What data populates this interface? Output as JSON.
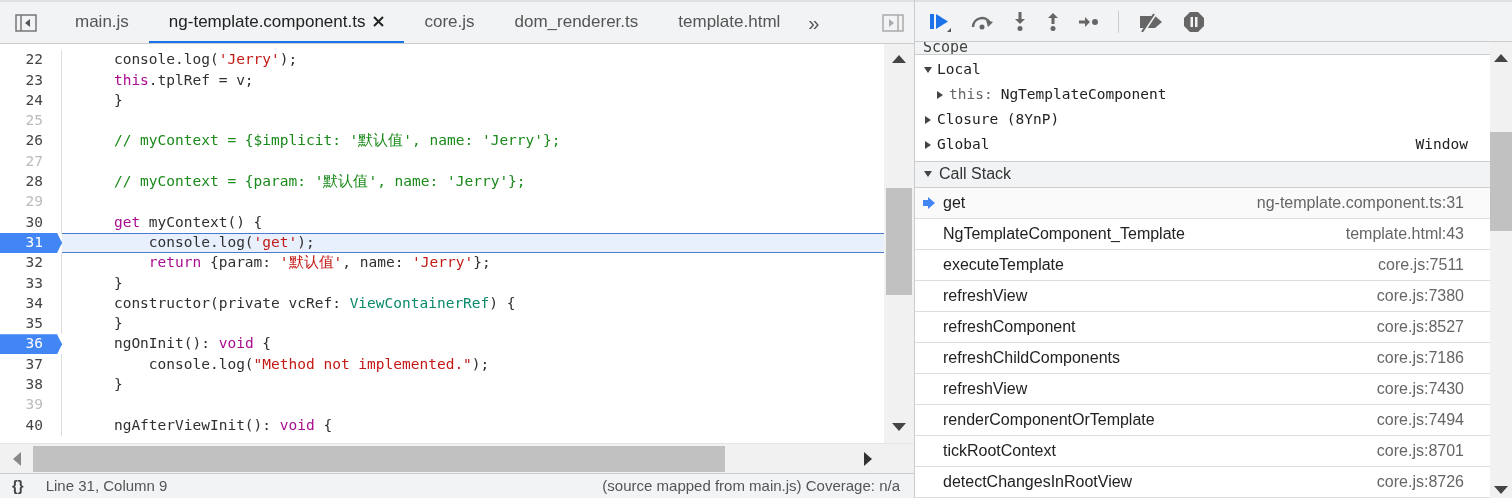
{
  "tabs": [
    {
      "label": "main.js",
      "selected": false,
      "closable": false
    },
    {
      "label": "ng-template.component.ts",
      "selected": true,
      "closable": true
    },
    {
      "label": "core.js",
      "selected": false,
      "closable": false
    },
    {
      "label": "dom_renderer.ts",
      "selected": false,
      "closable": false
    },
    {
      "label": "template.html",
      "selected": false,
      "closable": false
    }
  ],
  "tabs_overflow": "»",
  "code": [
    {
      "number": "22",
      "breakpoint": false,
      "current": false,
      "tokens": [
        {
          "kind": "plain",
          "text": "    console.log("
        },
        {
          "kind": "str",
          "text": "'Jerry'"
        },
        {
          "kind": "plain",
          "text": ");"
        }
      ]
    },
    {
      "number": "23",
      "breakpoint": false,
      "current": false,
      "tokens": [
        {
          "kind": "kw",
          "text": "    this"
        },
        {
          "kind": "plain",
          "text": ".tplRef = v;"
        }
      ]
    },
    {
      "number": "24",
      "breakpoint": false,
      "current": false,
      "tokens": [
        {
          "kind": "plain",
          "text": "    }"
        }
      ]
    },
    {
      "number": "25",
      "breakpoint": false,
      "current": false
    },
    {
      "number": "26",
      "breakpoint": false,
      "current": false,
      "tokens": [
        {
          "kind": "comment",
          "text": "    // myContext = {$implicit: '默认值', name: 'Jerry'};"
        }
      ]
    },
    {
      "number": "27",
      "breakpoint": false,
      "current": false
    },
    {
      "number": "28",
      "breakpoint": false,
      "current": false,
      "tokens": [
        {
          "kind": "comment",
          "text": "    // myContext = {param: '默认值', name: 'Jerry'};"
        }
      ]
    },
    {
      "number": "29",
      "breakpoint": false,
      "current": false
    },
    {
      "number": "30",
      "breakpoint": false,
      "current": false,
      "tokens": [
        {
          "kind": "kw",
          "text": "    get"
        },
        {
          "kind": "plain",
          "text": " myContext() {"
        }
      ]
    },
    {
      "number": "31",
      "breakpoint": true,
      "current": true,
      "tokens": [
        {
          "kind": "plain",
          "text": "        console.log("
        },
        {
          "kind": "str",
          "text": "'get'"
        },
        {
          "kind": "plain",
          "text": ");"
        }
      ]
    },
    {
      "number": "32",
      "breakpoint": false,
      "current": false,
      "tokens": [
        {
          "kind": "kw",
          "text": "        return"
        },
        {
          "kind": "plain",
          "text": " {param: "
        },
        {
          "kind": "str",
          "text": "'默认值'"
        },
        {
          "kind": "plain",
          "text": ", name: "
        },
        {
          "kind": "str",
          "text": "'Jerry'"
        },
        {
          "kind": "plain",
          "text": "};"
        }
      ]
    },
    {
      "number": "33",
      "breakpoint": false,
      "current": false,
      "tokens": [
        {
          "kind": "plain",
          "text": "    }"
        }
      ]
    },
    {
      "number": "34",
      "breakpoint": false,
      "current": false,
      "tokens": [
        {
          "kind": "plain",
          "text": "    constructor(private vcRef: "
        },
        {
          "kind": "type",
          "text": "ViewContainerRef"
        },
        {
          "kind": "plain",
          "text": ") {"
        }
      ]
    },
    {
      "number": "35",
      "breakpoint": false,
      "current": false,
      "tokens": [
        {
          "kind": "plain",
          "text": "    }"
        }
      ]
    },
    {
      "number": "36",
      "breakpoint": true,
      "current": false,
      "tokens": [
        {
          "kind": "plain",
          "text": "    ngOnInit(): "
        },
        {
          "kind": "kw",
          "text": "void"
        },
        {
          "kind": "plain",
          "text": " {"
        }
      ]
    },
    {
      "number": "37",
      "breakpoint": false,
      "current": false,
      "tokens": [
        {
          "kind": "plain",
          "text": "        console.log("
        },
        {
          "kind": "str",
          "text": "\"Method not implemented.\""
        },
        {
          "kind": "plain",
          "text": ");"
        }
      ]
    },
    {
      "number": "38",
      "breakpoint": false,
      "current": false,
      "tokens": [
        {
          "kind": "plain",
          "text": "    }"
        }
      ]
    },
    {
      "number": "39",
      "breakpoint": false,
      "current": false
    },
    {
      "number": "40",
      "breakpoint": false,
      "current": false,
      "tokens": [
        {
          "kind": "plain",
          "text": "    ngAfterViewInit(): "
        },
        {
          "kind": "kw",
          "text": "void"
        },
        {
          "kind": "plain",
          "text": " {"
        }
      ]
    }
  ],
  "status_bar": {
    "pretty_print": "{}",
    "position": "Line 31, Column 9",
    "info": "(source mapped from main.js) Coverage: n/a"
  },
  "scope": {
    "title": "Scope",
    "items": [
      {
        "name": "Local",
        "expanded": true,
        "children": [
          {
            "name": "this:",
            "value": "NgTemplateComponent",
            "expanded": false
          }
        ]
      },
      {
        "name": "Closure (8YnP)",
        "expanded": false
      },
      {
        "name": "Global",
        "expanded": false,
        "value": "Window"
      }
    ]
  },
  "call_stack": {
    "title": "Call Stack",
    "expanded": true,
    "frames": [
      {
        "name": "get",
        "location": "ng-template.component.ts:31",
        "selected": true
      },
      {
        "name": "NgTemplateComponent_Template",
        "location": "template.html:43",
        "selected": false
      },
      {
        "name": "executeTemplate",
        "location": "core.js:7511",
        "selected": false
      },
      {
        "name": "refreshView",
        "location": "core.js:7380",
        "selected": false
      },
      {
        "name": "refreshComponent",
        "location": "core.js:8527",
        "selected": false
      },
      {
        "name": "refreshChildComponents",
        "location": "core.js:7186",
        "selected": false
      },
      {
        "name": "refreshView",
        "location": "core.js:7430",
        "selected": false
      },
      {
        "name": "renderComponentOrTemplate",
        "location": "core.js:7494",
        "selected": false
      },
      {
        "name": "tickRootContext",
        "location": "core.js:8701",
        "selected": false
      },
      {
        "name": "detectChangesInRootView",
        "location": "core.js:8726",
        "selected": false
      }
    ]
  }
}
